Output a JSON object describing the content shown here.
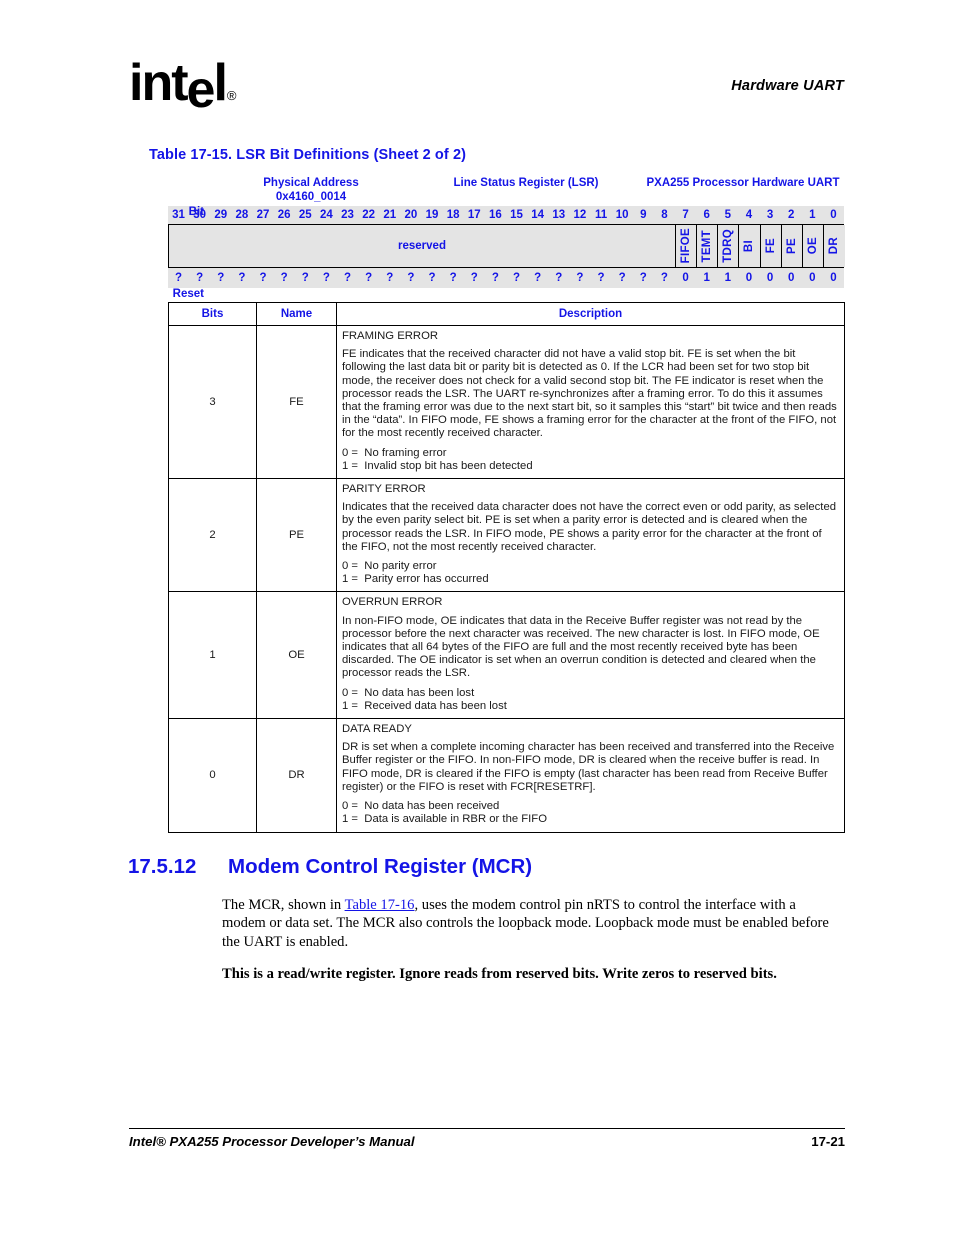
{
  "header": {
    "logo_text": "intel",
    "logo_reg": "®",
    "running_title": "Hardware UART"
  },
  "table_caption": "Table 17-15. LSR Bit Definitions (Sheet 2 of 2)",
  "register_diagram": {
    "physical_address_label": "Physical Address",
    "physical_address_value": "0x4160_0014",
    "register_name": "Line Status Register (LSR)",
    "unit_name": "PXA255 Processor Hardware UART",
    "bit_row_label": "Bit",
    "reset_row_label": "Reset",
    "bit_numbers": [
      "31",
      "30",
      "29",
      "28",
      "27",
      "26",
      "25",
      "24",
      "23",
      "22",
      "21",
      "20",
      "19",
      "18",
      "17",
      "16",
      "15",
      "14",
      "13",
      "12",
      "11",
      "10",
      "9",
      "8",
      "7",
      "6",
      "5",
      "4",
      "3",
      "2",
      "1",
      "0"
    ],
    "reserved_label": "reserved",
    "reserved_span": 24,
    "fields": [
      {
        "label": "FIFOE",
        "bit": 7
      },
      {
        "label": "TEMT",
        "bit": 6
      },
      {
        "label": "TDRQ",
        "bit": 5
      },
      {
        "label": "BI",
        "bit": 4
      },
      {
        "label": "FE",
        "bit": 3
      },
      {
        "label": "PE",
        "bit": 2
      },
      {
        "label": "OE",
        "bit": 1
      },
      {
        "label": "DR",
        "bit": 0
      }
    ],
    "reset_values": [
      "?",
      "?",
      "?",
      "?",
      "?",
      "?",
      "?",
      "?",
      "?",
      "?",
      "?",
      "?",
      "?",
      "?",
      "?",
      "?",
      "?",
      "?",
      "?",
      "?",
      "?",
      "?",
      "?",
      "?",
      "0",
      "1",
      "1",
      "0",
      "0",
      "0",
      "0",
      "0"
    ]
  },
  "bit_table": {
    "headers": {
      "bits": "Bits",
      "name": "Name",
      "description": "Description"
    },
    "rows": [
      {
        "bits": "3",
        "name": "FE",
        "title": "FRAMING ERROR",
        "body": "FE indicates that the received character did not have a valid stop bit. FE is set when the bit following the last data bit or parity bit is detected as 0. If the LCR had been set for two stop bit mode, the receiver does not check for a valid second stop bit. The FE indicator is reset when the processor reads the LSR. The UART re-synchronizes after a framing error. To do this it assumes that the framing error was due to the next start bit, so it samples this “start” bit twice and then reads in the “data”. In FIFO mode, FE shows a framing error for the character at the front of the FIFO, not for the most recently received character.",
        "enum0": "0 =  No framing error",
        "enum1": "1 =  Invalid stop bit has been detected"
      },
      {
        "bits": "2",
        "name": "PE",
        "title": "PARITY ERROR",
        "body": "Indicates that the received data character does not have the correct even or odd parity, as selected by the even parity select bit. PE is set when a parity error is detected and is cleared when the processor reads the LSR. In FIFO mode, PE shows a parity error for the character at the front of the FIFO, not the most recently received character.",
        "enum0": "0 =  No parity error",
        "enum1": "1 =  Parity error has occurred"
      },
      {
        "bits": "1",
        "name": "OE",
        "title": "OVERRUN ERROR",
        "body": "In non-FIFO mode, OE indicates that data in the Receive Buffer register was not read by the processor before the next character was received. The new character is lost. In FIFO mode, OE indicates that all 64 bytes of the FIFO are full and the most recently received byte has been discarded. The OE indicator is set when an overrun condition is detected and cleared when the processor reads the LSR.",
        "enum0": "0 =  No data has been lost",
        "enum1": "1 =  Received data has been lost"
      },
      {
        "bits": "0",
        "name": "DR",
        "title": "DATA READY",
        "body": "DR is set when a complete incoming character has been received and transferred into the Receive Buffer register or the FIFO. In non-FIFO mode, DR is cleared when the receive buffer is read. In FIFO mode, DR is cleared if the FIFO is empty (last character has been read from Receive Buffer register) or the FIFO is reset with FCR[RESETRF].",
        "enum0": "0 =  No data has been received",
        "enum1": "1 =  Data is available in RBR or the FIFO"
      }
    ]
  },
  "section": {
    "number": "17.5.12",
    "title": "Modem Control Register (MCR)",
    "body_part1": "The MCR, shown in ",
    "body_xref": "Table 17-16",
    "body_part2": ", uses the modem control pin nRTS to control the interface with a modem or data set. The MCR also controls the loopback mode. Loopback mode must be enabled before the UART is enabled.",
    "note": "This is a read/write register. Ignore reads from reserved bits. Write zeros to reserved bits."
  },
  "footer": {
    "left": "Intel® PXA255 Processor Developer’s Manual",
    "right": "17-21"
  },
  "colors": {
    "accent_blue": "#1414e6",
    "grid_gray": "#e4e4e4",
    "text_black": "#1a1a1a"
  }
}
